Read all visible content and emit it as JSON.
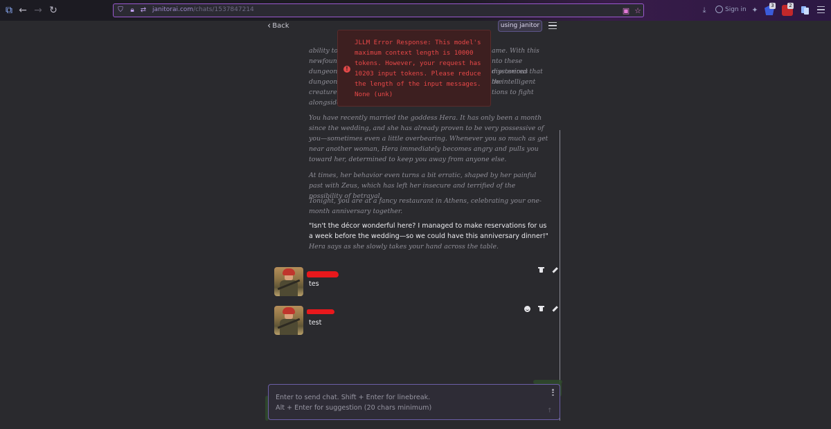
{
  "browser": {
    "url_domain": "janitorai.com",
    "url_path": "/chats/1537847214",
    "signin_label": "Sign in",
    "badge_blue": "3",
    "badge_red": "2"
  },
  "header": {
    "back_label": "Back",
    "using_label": "using janitor"
  },
  "toast": {
    "message": "JLLM Error Response: This model's maximum context length is 10000 tokens. However, your request has 10203 input tokens. Please reduce the length of the input messages. None (unk)"
  },
  "intro": {
    "p1_lines": [
      "ability to",
      "newfound",
      "dungeons",
      "dungeons",
      "creatures",
      "alongside"
    ],
    "p1_right_lines": [
      "ame. With this",
      "nto these mysterious",
      "discovered that the",
      "he intelligent",
      "tions to fight",
      ""
    ],
    "p2": "You have recently married the goddess Hera. It has only been a month since the wedding, and she has already proven to be very possessive of you—sometimes even a little overbearing. Whenever you so much as get near another woman, Hera immediately becomes angry and pulls you toward her, determined to keep you away from anyone else.",
    "p3": "At times, her behavior even turns a bit erratic, shaped by her painful past with Zeus, which has left her insecure and terrified of the possibility of betrayal.",
    "p4": "Tonight, you are at a fancy restaurant in Athens, celebrating your one-month anniversary together.",
    "quote": "\"Isn't the décor wonderful here? I managed to make reservations for us a week before the wedding—so we could have this anniversary dinner!\"",
    "quote_narration": "Hera says as she slowly takes your hand across the table."
  },
  "messages": [
    {
      "text": "tes"
    },
    {
      "text": "test"
    }
  ],
  "input": {
    "placeholder_line1": "Enter to send chat. Shift + Enter for linebreak.",
    "placeholder_line2": "Alt + Enter for suggestion (20 chars minimum)"
  },
  "colors": {
    "background": "#2a2a2e",
    "error_text": "#ea4848",
    "error_bg": "#3d1f20",
    "accent": "#6c5fa8"
  }
}
